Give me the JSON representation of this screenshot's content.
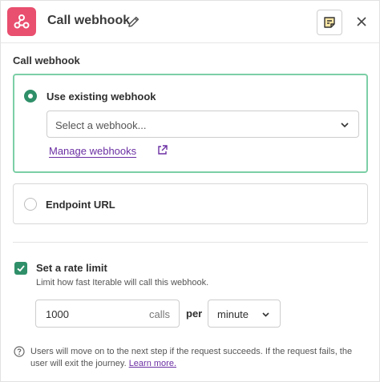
{
  "header": {
    "title": "Call webhook",
    "app_icon": "webhook-icon",
    "accent_color": "#e94f6f",
    "edit_icon": "pencil-icon",
    "note_icon": "note-icon",
    "close_icon": "close-icon"
  },
  "section": {
    "title": "Call webhook"
  },
  "options": {
    "existing": {
      "label": "Use existing webhook",
      "selected": true,
      "select_placeholder": "Select a webhook...",
      "manage_link": "Manage webhooks"
    },
    "endpoint": {
      "label": "Endpoint URL",
      "selected": false
    }
  },
  "rate_limit": {
    "checked": true,
    "label": "Set a rate limit",
    "help": "Limit how fast Iterable will call this webhook.",
    "calls_value": "1000",
    "calls_suffix": "calls",
    "per_label": "per",
    "period": "minute"
  },
  "footer": {
    "text": "Users will move on to the next step if the request succeeds. If the request fails, the user will exit the journey.",
    "learn_more": "Learn more."
  },
  "colors": {
    "selected_border": "#7ccfa6",
    "success": "#2f8f69",
    "link": "#6b2fa3"
  }
}
